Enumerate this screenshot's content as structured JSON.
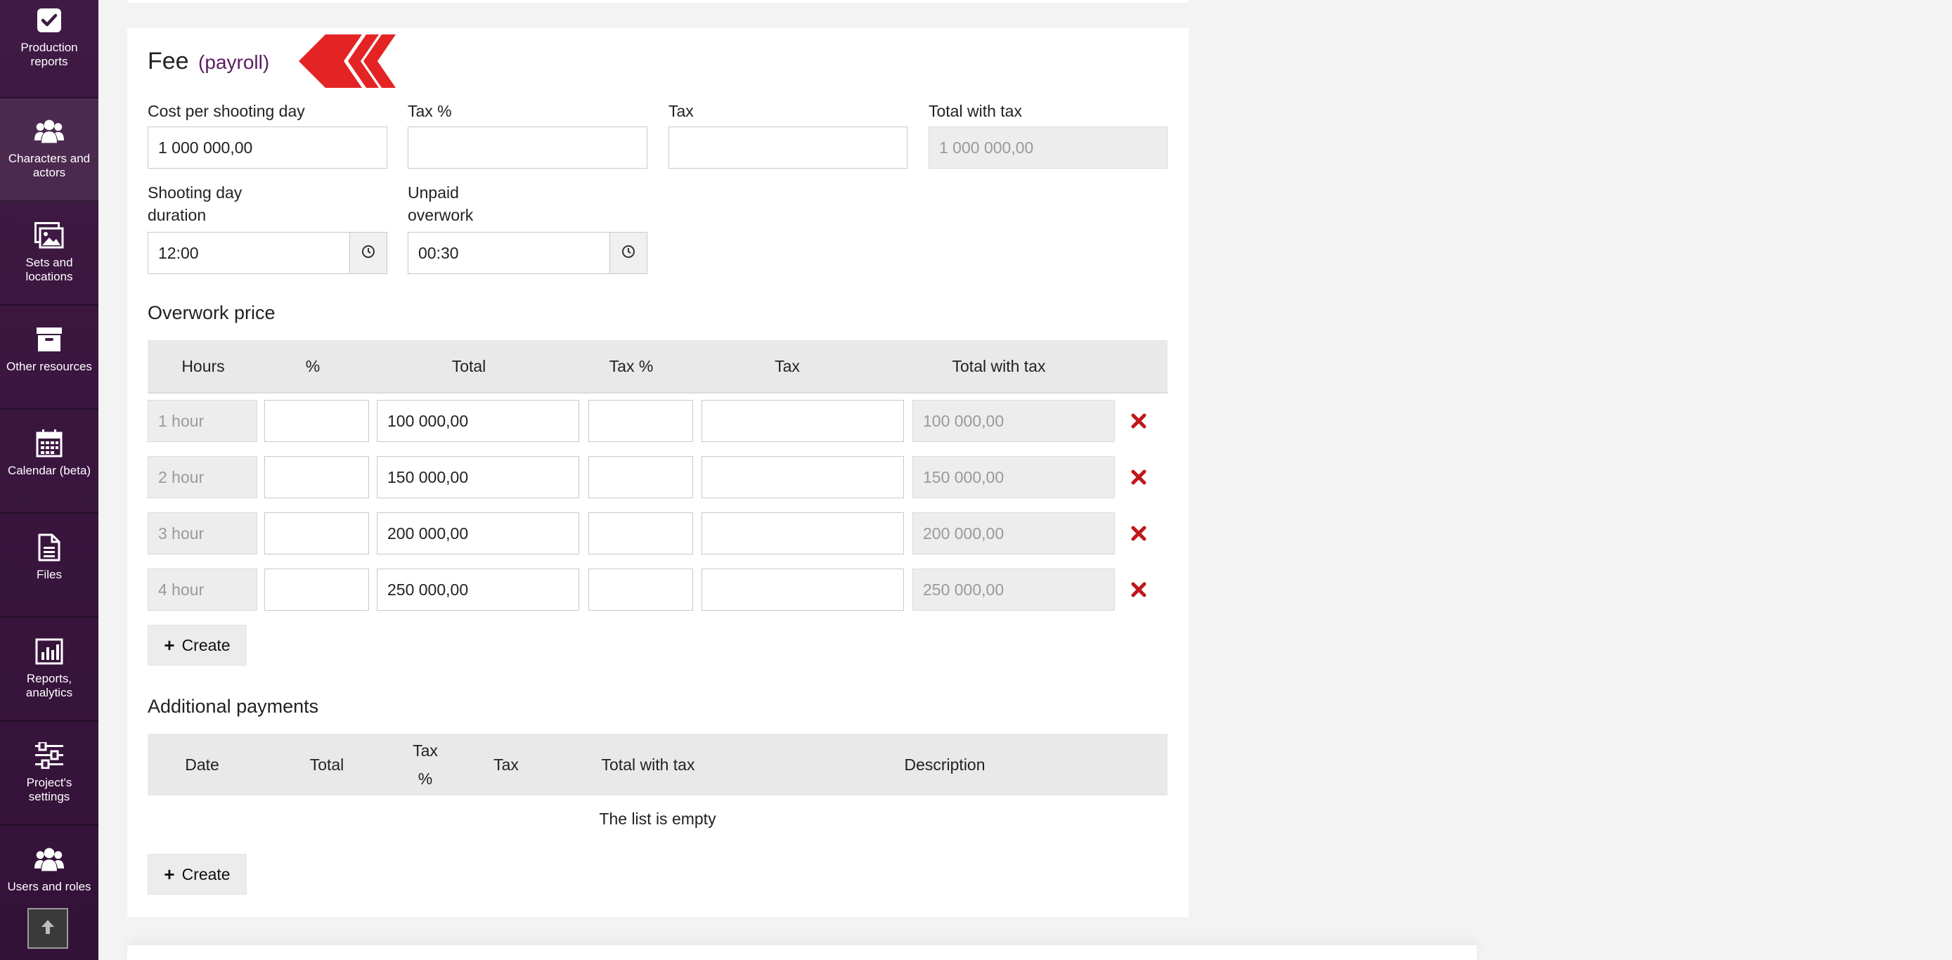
{
  "sidebar": {
    "items": [
      {
        "label": "Production reports",
        "icon": "checkbox-icon"
      },
      {
        "label": "Characters and actors",
        "icon": "users-icon"
      },
      {
        "label": "Sets and locations",
        "icon": "images-icon"
      },
      {
        "label": "Other resources",
        "icon": "archive-icon"
      },
      {
        "label": "Calendar (beta)",
        "icon": "calendar-icon"
      },
      {
        "label": "Files",
        "icon": "file-icon"
      },
      {
        "label": "Reports, analytics",
        "icon": "bar-chart-icon"
      },
      {
        "label": "Project's settings",
        "icon": "sliders-icon"
      },
      {
        "label": "Users and roles",
        "icon": "users-icon"
      }
    ],
    "scroll_top_icon": "arrow-up-icon"
  },
  "fee": {
    "title": "Fee",
    "subtitle": "(payroll)",
    "cost_per_day_label": "Cost per shooting day",
    "cost_per_day_value": "1 000 000,00",
    "tax_percent_label": "Tax %",
    "tax_percent_value": "",
    "tax_label": "Tax",
    "tax_value": "",
    "total_with_tax_label": "Total with tax",
    "total_with_tax_value": "1 000 000,00",
    "shooting_duration_label_line1": "Shooting day",
    "shooting_duration_label_line2": "duration",
    "shooting_duration_value": "12:00",
    "unpaid_overwork_label_line1": "Unpaid",
    "unpaid_overwork_label_line2": "overwork",
    "unpaid_overwork_value": "00:30"
  },
  "overwork": {
    "title": "Overwork price",
    "columns": [
      "Hours",
      "%",
      "Total",
      "Tax %",
      "Tax",
      "Total with tax"
    ],
    "rows": [
      {
        "hours": "1 hour",
        "percent": "",
        "total": "100 000,00",
        "tax_percent": "",
        "tax": "",
        "total_with_tax": "100 000,00"
      },
      {
        "hours": "2 hour",
        "percent": "",
        "total": "150 000,00",
        "tax_percent": "",
        "tax": "",
        "total_with_tax": "150 000,00"
      },
      {
        "hours": "3 hour",
        "percent": "",
        "total": "200 000,00",
        "tax_percent": "",
        "tax": "",
        "total_with_tax": "200 000,00"
      },
      {
        "hours": "4 hour",
        "percent": "",
        "total": "250 000,00",
        "tax_percent": "",
        "tax": "",
        "total_with_tax": "250 000,00"
      }
    ],
    "create_label": "Create"
  },
  "additional": {
    "title": "Additional payments",
    "columns": [
      "Date",
      "Total",
      "Tax",
      "%",
      "Tax",
      "Total with tax",
      "Description"
    ],
    "empty_text": "The list is empty",
    "create_label": "Create"
  },
  "colors": {
    "sidebar_bg": "#3f1a44",
    "accent_purple": "#5b1d63",
    "delete_red": "#c0161b",
    "chevron_red": "#e42424"
  }
}
